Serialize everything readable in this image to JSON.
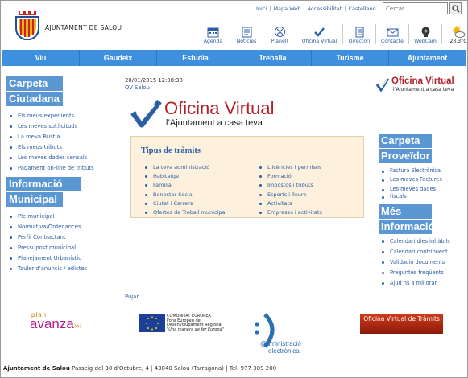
{
  "header": {
    "brand": "AJUNTAMENT DE SALOU",
    "top_links": [
      "Inici",
      "Mapa Web",
      "Accessibilitat",
      "Castellano"
    ],
    "search_placeholder": "Cercar...",
    "icons": [
      {
        "label": "Agenda",
        "icon": "calendar-icon"
      },
      {
        "label": "Notícies",
        "icon": "news-icon"
      },
      {
        "label": "Planell",
        "icon": "map-icon"
      },
      {
        "label": "Oficina Virtual",
        "icon": "checkmark-icon"
      },
      {
        "label": "Directori",
        "icon": "directory-icon"
      },
      {
        "label": "Contacte",
        "icon": "mail-icon"
      },
      {
        "label": "WebCam",
        "icon": "webcam-icon"
      },
      {
        "label": "23.3°C",
        "icon": "weather-icon"
      }
    ]
  },
  "nav": [
    "Viu",
    "Gaudeix",
    "Estudia",
    "Treballa",
    "Turisme",
    "Ajuntament"
  ],
  "left": {
    "carpeta_title": [
      "Carpeta",
      "Ciutadana"
    ],
    "carpeta_items": [
      "Els meus expedients",
      "Les meves sol.licituds",
      "La meva Bústia",
      "Els meus tributs",
      "Les meves dades censals",
      "Pagament on-line de tributs"
    ],
    "info_title": [
      "Informació",
      "Municipal"
    ],
    "info_items": [
      "Ple municipal",
      "Normativa/Ordenances",
      "Perfil Contractant",
      "Pressupost municipal",
      "Planejament Urbanístic",
      "Tauler d'anuncis / edictes"
    ]
  },
  "center": {
    "datetime": "20/01/2015 12:38:38",
    "ov_link": "OV Salou",
    "logo_title": "Oficina Virtual",
    "logo_subtitle": "l’Ajuntament a casa teva",
    "tramits_title": "Tipus de tràmits",
    "tramits_col1": [
      "La teva administració",
      "Habitatge",
      "Família",
      "Benestar Social",
      "Ciutat i Carrers",
      "Ofertes de Treball municipal"
    ],
    "tramits_col2": [
      "Llicències i permisos",
      "Formació",
      "Impostos i tributs",
      "Esports i lleure",
      "Activitats",
      "Empreses i activitats"
    ],
    "pujar": "Pujar"
  },
  "right": {
    "prov_title": [
      "Carpeta",
      "Proveïdor"
    ],
    "prov_items": [
      "Factura Electrònica",
      "Les meves Factures",
      "Les meves dades",
      "fiscals"
    ],
    "mes_title": [
      "Més",
      "Informació"
    ],
    "mes_items": [
      "Calendari dies inhàbils",
      "Calendari contribuent",
      "Validació documents",
      "Preguntes freqüents",
      "Ajud’ns a millorar"
    ]
  },
  "logos": {
    "plan_small": "plan",
    "plan_big": "avanza",
    "eu_line1": "COMUNITAT EUROPEA",
    "eu_line2": "Fons Europeu de",
    "eu_line3": "Desenvolupament Regional",
    "eu_line4": "\"Una manera de fer Europa\"",
    "admin_line1": "@dministració",
    "admin_line2": "electrònica",
    "ovt": "Oficina Virtual de Tràmits"
  },
  "footer": {
    "name": "Ajuntament de Salou",
    "address": "Passeig del 30 d'Octubre, 4 | 43840 Salou (Tarragona) | Tel. 977 309 200"
  },
  "colors": {
    "nav": "#3e8fdd",
    "section_title": "#5b97d3",
    "link": "#2a5fa5",
    "panel": "#fdf1dd",
    "ov_red": "#b4202a"
  }
}
